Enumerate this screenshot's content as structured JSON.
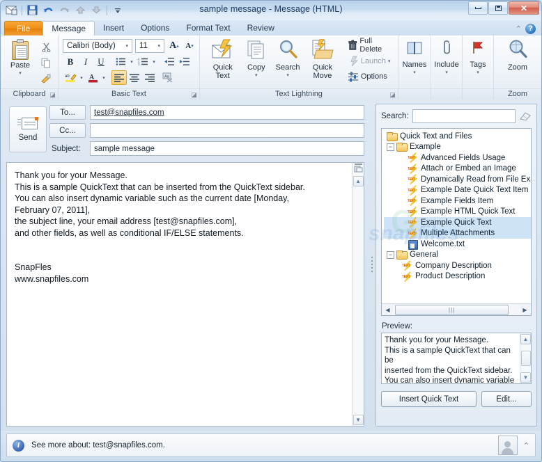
{
  "window": {
    "title": "sample message  -  Message (HTML)",
    "app_icon": "envelope-window-icon",
    "minimize_label": "Minimize",
    "restore_label": "Restore",
    "close_label": "Close"
  },
  "quick_access": [
    {
      "name": "app-menu-icon",
      "glyph": "✉"
    },
    {
      "name": "save-icon",
      "glyph": "ὋE"
    },
    {
      "name": "undo-icon",
      "glyph": "↶"
    },
    {
      "name": "redo-icon",
      "glyph": "↻"
    },
    {
      "name": "previous-item-icon",
      "glyph": "▲"
    },
    {
      "name": "next-item-icon",
      "glyph": "▼"
    },
    {
      "name": "customize-qat-icon",
      "glyph": "▾"
    }
  ],
  "tabs": [
    {
      "label": "File",
      "kind": "file"
    },
    {
      "label": "Message",
      "kind": "active"
    },
    {
      "label": "Insert",
      "kind": "normal"
    },
    {
      "label": "Options",
      "kind": "normal"
    },
    {
      "label": "Format Text",
      "kind": "normal"
    },
    {
      "label": "Review",
      "kind": "normal"
    }
  ],
  "tab_right": {
    "collapse_ribbon": "⌃",
    "help": "?"
  },
  "ribbon": {
    "groups": [
      {
        "label": "Clipboard",
        "has_launcher": true
      },
      {
        "label": "Basic Text",
        "has_launcher": true
      },
      {
        "label": "Text Lightning",
        "has_launcher": true
      },
      {
        "label": "",
        "has_launcher": false
      },
      {
        "label": "Zoom",
        "has_launcher": false
      }
    ],
    "clipboard": {
      "paste_label": "Paste",
      "paste_caret": "▾",
      "cut_label": "Cut",
      "copy_label": "Copy",
      "format_painter_label": "Format Painter"
    },
    "basic_text": {
      "font_name": "Calibri (Body)",
      "font_size": "11",
      "grow_font": "A",
      "shrink_font": "A",
      "bold": "B",
      "italic": "I",
      "underline": "U",
      "bullets": "bullet-list",
      "numbering": "numbered-list",
      "decrease_indent": "decrease-indent",
      "increase_indent": "increase-indent",
      "highlight": "ab",
      "font_color": "A",
      "align_left": "align-left",
      "align_center": "align-center",
      "align_right": "align-right",
      "clear_formatting": "clear-formatting"
    },
    "text_lightning": {
      "quick_text": "Quick\nText",
      "quick_text_l1": "Quick",
      "quick_text_l2": "Text",
      "copy_l1": "Copy",
      "search_l1": "Search",
      "quick_move_l1": "Quick",
      "quick_move_l2": "Move",
      "full_delete": "Full Delete",
      "launch": "Launch",
      "options": "Options",
      "caret": "▾"
    },
    "names": {
      "label": "Names",
      "caret": "▾"
    },
    "include": {
      "label": "Include",
      "caret": "▾"
    },
    "tags": {
      "label": "Tags",
      "caret": "▾"
    },
    "zoom": {
      "label": "Zoom"
    }
  },
  "compose": {
    "send_label": "Send",
    "to_button": "To...",
    "cc_button": "Cc...",
    "subject_label": "Subject:",
    "to_value": "test@snapfiles.com",
    "cc_value": "",
    "subject_value": "sample message",
    "body_lines": [
      "Thank you for your Message.",
      "This is a sample QuickText that can be inserted from the QuickText sidebar.",
      "You can also insert dynamic variable such as the current date [Monday,",
      "February 07, 2011],",
      "the subject line, your email address [test@snapfiles.com],",
      "and other  fields, as well as conditional IF/ELSE statements.",
      "",
      "",
      "SnapFles",
      "www.snapfiles.com"
    ]
  },
  "panel": {
    "search_label": "Search:",
    "search_value": "",
    "search_placeholder": "",
    "clear_icon": "eraser-icon",
    "tree": [
      {
        "label": "Quick Text and Files",
        "icon": "folder",
        "level": 0,
        "expander": "",
        "selected": false
      },
      {
        "label": "Example",
        "icon": "folder",
        "level": 1,
        "expander": "−",
        "selected": false
      },
      {
        "label": "Advanced Fields Usage",
        "icon": "quicktext",
        "level": 2,
        "expander": "",
        "selected": false
      },
      {
        "label": "Attach or Embed an Image",
        "icon": "quicktext",
        "level": 2,
        "expander": "",
        "selected": false
      },
      {
        "label": "Dynamically Read from File Exam",
        "icon": "quicktext",
        "level": 2,
        "expander": "",
        "selected": false
      },
      {
        "label": "Example Date Quick Text Item",
        "icon": "quicktext",
        "level": 2,
        "expander": "",
        "selected": false
      },
      {
        "label": "Example Fields Item",
        "icon": "quicktext",
        "level": 2,
        "expander": "",
        "selected": false
      },
      {
        "label": "Example HTML Quick Text",
        "icon": "quicktext",
        "level": 2,
        "expander": "",
        "selected": false
      },
      {
        "label": "Example Quick Text",
        "icon": "quicktext",
        "level": 2,
        "expander": "",
        "selected": true
      },
      {
        "label": "Multiple Attachments",
        "icon": "quicktext",
        "level": 2,
        "expander": "",
        "selected": true
      },
      {
        "label": "Welcome.txt",
        "icon": "disk",
        "level": 2,
        "expander": "",
        "selected": false
      },
      {
        "label": "General",
        "icon": "folder",
        "level": 1,
        "expander": "−",
        "selected": false
      },
      {
        "label": "Company Description",
        "icon": "quicktext",
        "level": 2,
        "expander": "",
        "selected": false
      },
      {
        "label": "Product Description",
        "icon": "quicktext",
        "level": 2,
        "expander": "",
        "selected": false
      }
    ],
    "hscroll": {
      "left_arrow": "◀",
      "right_arrow": "▶",
      "thumb_grip": "|||"
    },
    "preview_label": "Preview:",
    "preview_lines": [
      "Thank you for your Message.",
      "This is a sample QuickText that can be",
      "inserted from the QuickText sidebar.",
      "You can also insert dynamic variable"
    ],
    "insert_button": "Insert Quick Text",
    "edit_button": "Edit..."
  },
  "status": {
    "info_icon": "info-icon",
    "text": "See more about: test@snapfiles.com.",
    "avatar": "contact-photo-placeholder",
    "expand_icon": "⌃"
  },
  "watermarks": {
    "one": "G",
    "two": "snapfiles"
  },
  "colors": {
    "accent_orange": "#ef8d13",
    "selection_blue": "#cfe3f7",
    "title_blue": "#c7dcf2",
    "close_red": "#cf5e4c"
  }
}
